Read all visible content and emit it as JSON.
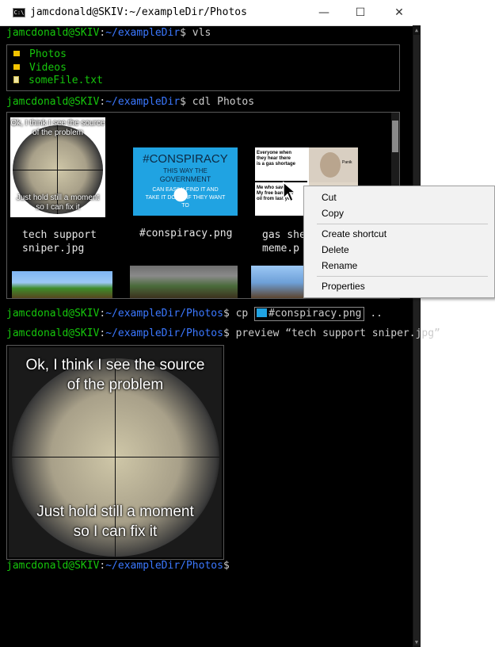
{
  "window": {
    "title": "jamcdonald@SKIV:~/exampleDir/Photos",
    "minimize_glyph": "—",
    "maximize_glyph": "☐",
    "close_glyph": "✕"
  },
  "prompt": {
    "user_host": "jamcdonald@SKIV",
    "colon": ":",
    "dollar": "$"
  },
  "commands": [
    {
      "path": "~/exampleDir",
      "cmd": " vls"
    },
    {
      "path": "~/exampleDir",
      "cmd": " cdl Photos"
    },
    {
      "path": "~/exampleDir/Photos",
      "cmd_prefix": " cp ",
      "chip_label": "#conspiracy.png",
      "cmd_suffix": " .."
    },
    {
      "path": "~/exampleDir/Photos",
      "cmd": " preview “tech support sniper.jpg”"
    },
    {
      "path": "~/exampleDir/Photos",
      "cmd": ""
    }
  ],
  "vls_items": [
    {
      "name": "Photos",
      "icon": "folder-icon"
    },
    {
      "name": "Videos",
      "icon": "folder-icon"
    },
    {
      "name": "someFile.txt",
      "icon": "file-icon"
    }
  ],
  "thumbnails": [
    {
      "caption_line1": "tech support",
      "caption_line2": "sniper.jpg"
    },
    {
      "caption_line1": "#conspiracy.png",
      "caption_line2": ""
    },
    {
      "caption_line1": "gas she",
      "caption_line2": "meme.p"
    }
  ],
  "meme_sniper": {
    "top": "Ok, I think I see the source of the problem",
    "top_line1": "Ok, I think I see the source",
    "top_line2": "of the problem",
    "bottom_line1": "Just hold still a moment",
    "bottom_line2": "so I can fix it"
  },
  "meme_conspiracy": {
    "title": "#CONSPIRACY",
    "l1": "THIS WAY THE",
    "l2": "GOVERNMENT",
    "l3": "CAN EASILY FIND IT AND",
    "l4": "TAKE IT DOWN IF THEY WANT",
    "l5": "TO"
  },
  "meme_gas": {
    "top1": "Everyone when",
    "top2": "they hear there",
    "top3": "is a gas shortage",
    "bot1": "Me who saw",
    "bot2": "My free barrel of",
    "bot3": "oil from last yea",
    "panik": "Panik"
  },
  "context_menu": {
    "items": [
      "Cut",
      "Copy",
      "Create shortcut",
      "Delete",
      "Rename",
      "Properties"
    ]
  },
  "colors": {
    "terminal_bg": "#000000",
    "prompt_user": "#16c60c",
    "prompt_path": "#3b78ff",
    "text": "#cccccc"
  }
}
